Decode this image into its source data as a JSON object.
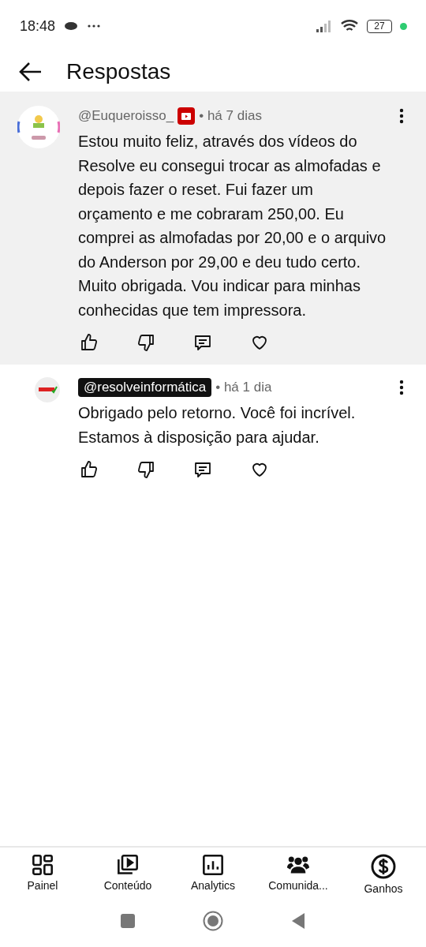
{
  "status_bar": {
    "time": "18:48",
    "battery": "27"
  },
  "header": {
    "title": "Respostas"
  },
  "comments": [
    {
      "author": "@Euqueroisso_",
      "kind": "viewer",
      "member_badge": true,
      "time": "• há 7 dias",
      "text": "Estou muito feliz, através dos vídeos do Resolve eu consegui trocar as almofadas e depois fazer o reset. Fui fazer um orçamento e me cobraram 250,00. Eu comprei as almofadas por 20,00 e o arquivo do Anderson por 29,00 e deu tudo certo. Muito obrigada. Vou indicar para minhas conhecidas que tem impressora.",
      "highlighted": true,
      "reply": false
    },
    {
      "author": "@resolveinformática",
      "kind": "creator",
      "member_badge": false,
      "time": "• há 1 dia",
      "text": "Obrigado pelo retorno. Você foi incrível. Estamos à disposição para ajudar.",
      "highlighted": false,
      "reply": true
    }
  ],
  "bottom_nav": [
    {
      "label": "Painel",
      "kind": "dashboard"
    },
    {
      "label": "Conteúdo",
      "kind": "content"
    },
    {
      "label": "Analytics",
      "kind": "analytics"
    },
    {
      "label": "Comunida...",
      "kind": "community"
    },
    {
      "label": "Ganhos",
      "kind": "earnings"
    }
  ]
}
